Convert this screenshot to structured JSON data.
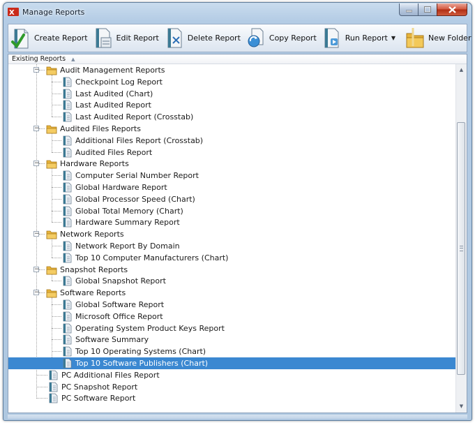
{
  "window": {
    "title": "Manage Reports"
  },
  "toolbar": {
    "create_label": "Create Report",
    "edit_label": "Edit Report",
    "delete_label": "Delete Report",
    "copy_label": "Copy Report",
    "run_label": "Run Report",
    "new_folder_label": "New Folder"
  },
  "list": {
    "header": "Existing Reports",
    "tree": [
      {
        "type": "folder",
        "label": "Audit Management Reports"
      },
      {
        "type": "report",
        "label": "Checkpoint Log Report"
      },
      {
        "type": "report",
        "label": "Last Audited (Chart)"
      },
      {
        "type": "report",
        "label": "Last Audited Report"
      },
      {
        "type": "report",
        "label": "Last Audited Report (Crosstab)"
      },
      {
        "type": "folder",
        "label": "Audited Files Reports"
      },
      {
        "type": "report",
        "label": "Additional Files Report (Crosstab)"
      },
      {
        "type": "report",
        "label": "Audited Files Report"
      },
      {
        "type": "folder",
        "label": "Hardware Reports"
      },
      {
        "type": "report",
        "label": "Computer Serial Number Report"
      },
      {
        "type": "report",
        "label": "Global Hardware Report"
      },
      {
        "type": "report",
        "label": "Global Processor Speed (Chart)"
      },
      {
        "type": "report",
        "label": "Global Total Memory (Chart)"
      },
      {
        "type": "report",
        "label": "Hardware Summary Report"
      },
      {
        "type": "folder",
        "label": "Network Reports"
      },
      {
        "type": "report",
        "label": "Network Report By Domain"
      },
      {
        "type": "report",
        "label": "Top 10 Computer Manufacturers (Chart)"
      },
      {
        "type": "folder",
        "label": "Snapshot Reports"
      },
      {
        "type": "report",
        "label": "Global Snapshot Report"
      },
      {
        "type": "folder",
        "label": "Software Reports"
      },
      {
        "type": "report",
        "label": "Global Software Report"
      },
      {
        "type": "report",
        "label": "Microsoft Office Report"
      },
      {
        "type": "report",
        "label": "Operating System Product Keys Report"
      },
      {
        "type": "report",
        "label": "Software Summary"
      },
      {
        "type": "report",
        "label": "Top 10 Operating Systems (Chart)"
      },
      {
        "type": "report",
        "label": "Top 10 Software Publishers (Chart)",
        "selected": true
      },
      {
        "type": "report",
        "label": "PC Additional Files Report"
      },
      {
        "type": "report",
        "label": "PC Snapshot Report"
      },
      {
        "type": "report",
        "label": "PC Software Report"
      }
    ]
  },
  "colors": {
    "selection": "#3b88d1",
    "folder": "#e8b43a",
    "window_frame": "#aec7e0"
  }
}
